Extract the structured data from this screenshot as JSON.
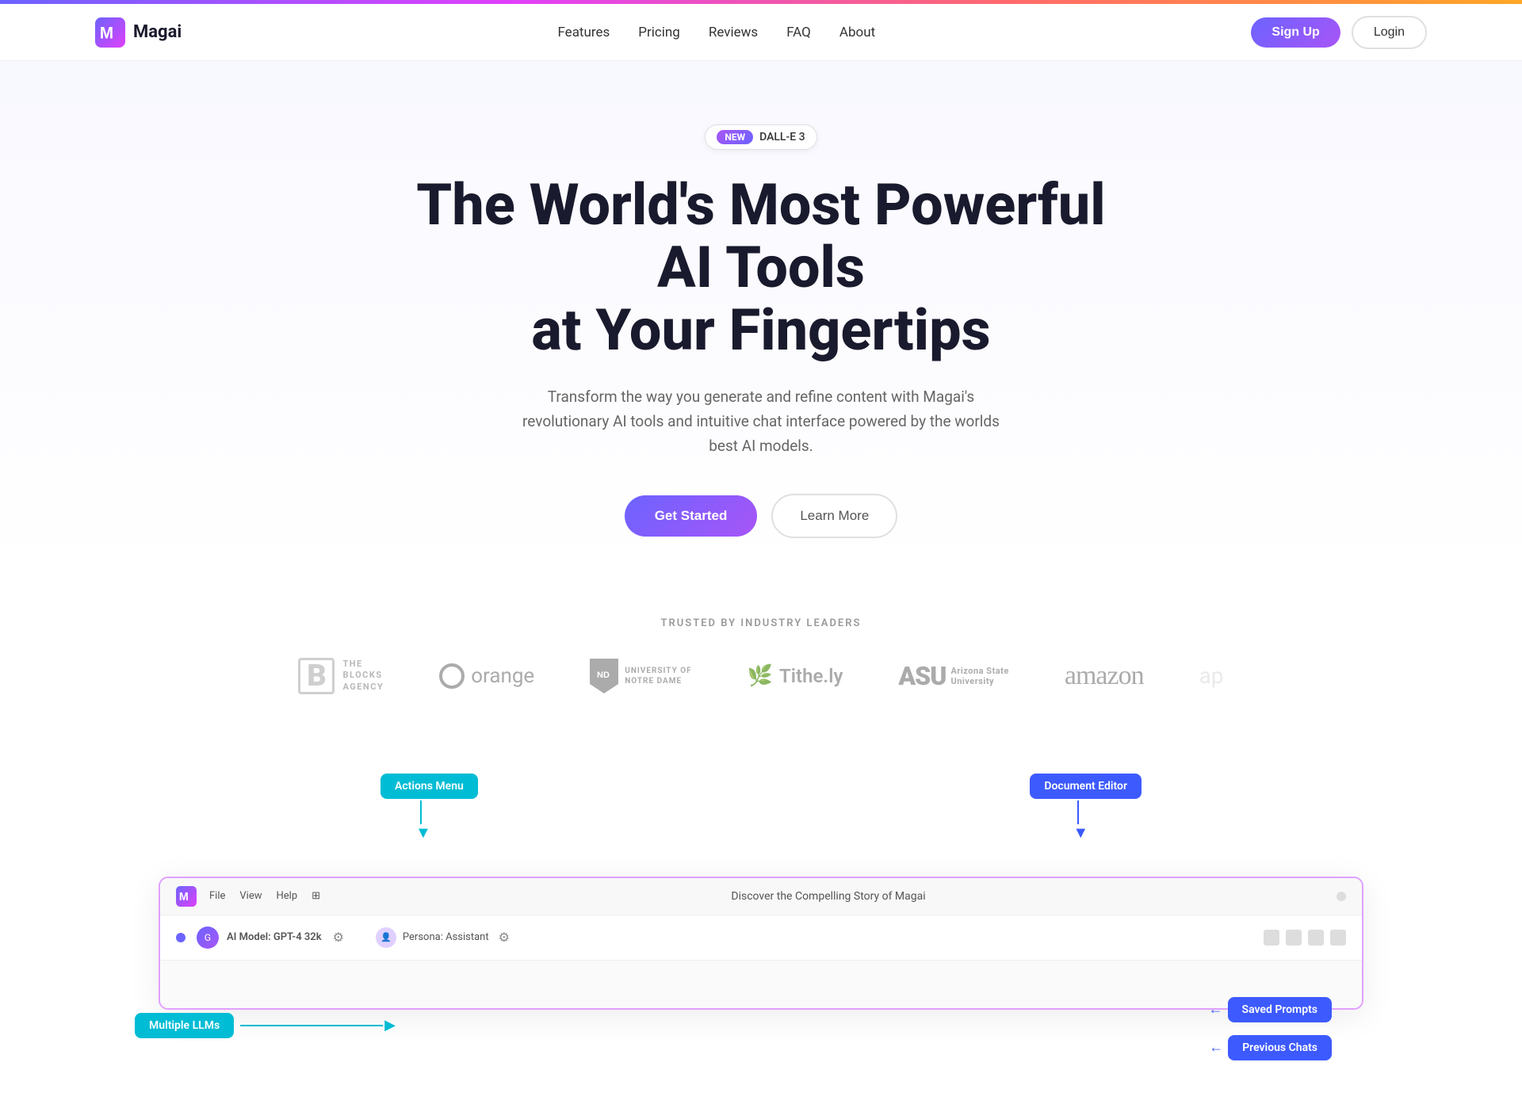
{
  "topbar": {
    "gradient": "linear-gradient(90deg, #6c63ff, #e040fb, #ff6b6b, #ffa726)"
  },
  "navbar": {
    "logo_text": "Magai",
    "links": [
      "Features",
      "Pricing",
      "Reviews",
      "FAQ",
      "About"
    ],
    "signup_label": "Sign Up",
    "login_label": "Login"
  },
  "hero": {
    "badge_new": "NEW",
    "badge_name": "DALL-E 3",
    "title_line1": "The World's Most Powerful AI Tools",
    "title_line2": "at Your Fingertips",
    "subtitle": "Transform the way you generate and refine content with Magai's revolutionary AI tools and intuitive chat interface powered by the worlds best AI models.",
    "cta_primary": "Get Started",
    "cta_secondary": "Learn More"
  },
  "trusted": {
    "label": "TRUSTED BY INDUSTRY LEADERS",
    "logos": [
      {
        "name": "The Blocks Agency",
        "type": "blocks"
      },
      {
        "name": "Orange",
        "type": "orange"
      },
      {
        "name": "University of Notre Dame",
        "type": "notre-dame"
      },
      {
        "name": "Tithe.ly",
        "type": "tithe"
      },
      {
        "name": "Arizona State University",
        "type": "asu"
      },
      {
        "name": "Amazon",
        "type": "amazon"
      }
    ]
  },
  "demo": {
    "annotation_actions_menu": "Actions Menu",
    "annotation_doc_editor": "Document Editor",
    "annotation_multiple_llm": "Multiple LLMs",
    "annotation_saved_prompts": "Saved Prompts",
    "annotation_prev_chats": "Previous Chats",
    "window_title": "Discover the Compelling Story of Magai",
    "menu_items": [
      "File",
      "View",
      "Help"
    ],
    "model_label": "AI Model: GPT-4 32k",
    "persona_label": "Persona: Assistant"
  }
}
